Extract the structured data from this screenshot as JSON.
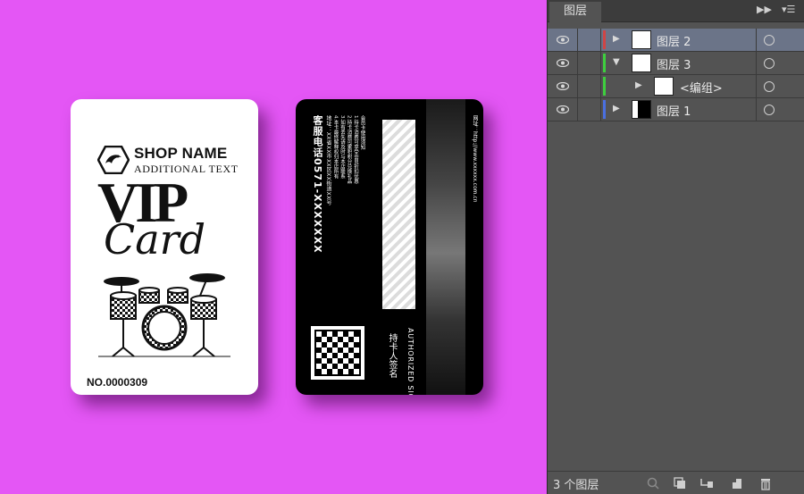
{
  "canvas": {
    "background": "#e456f5"
  },
  "card_front": {
    "shop_name": "SHOP NAME",
    "additional_text": "ADDITIONAL TEXT",
    "vip": "VIP",
    "card_word": "Card",
    "card_number": "NO.0000309"
  },
  "card_back": {
    "hotline": "客服电话0571-XXXXXXX",
    "address": "地址：XX省XX市XX区XX街道XX号",
    "rules": [
      "会员卡使用须知",
      "1.持卡消费可享受会员折扣优惠",
      "2.持卡消费可累积积分兑换礼品",
      "3.如有丢失请及时与本店联系",
      "4.本卡最终解释权归本店所有"
    ],
    "authorized_en": "AUTHORIZED SIGNATURE",
    "authorized_cn": "持卡人签名",
    "website": "网址：http://www.xxxxxx.com.cn"
  },
  "layers_panel": {
    "tab_title": "图层",
    "collapse_icon": "double-chevron-right-icon",
    "menu_icon": "panel-menu-icon",
    "layers": [
      {
        "name": "图层 2",
        "color": "#d04545",
        "expanded": false,
        "selected": true,
        "indent": 0
      },
      {
        "name": "图层 3",
        "color": "#3ecf3e",
        "expanded": true,
        "selected": false,
        "indent": 0
      },
      {
        "name": "<编组>",
        "color": "#3ecf3e",
        "expanded": false,
        "selected": false,
        "indent": 1
      },
      {
        "name": "图层 1",
        "color": "#4a6fe0",
        "expanded": false,
        "selected": false,
        "indent": 0
      }
    ],
    "footer": {
      "layer_count": "3 个图层",
      "icons": [
        "locate-object-icon",
        "make-clipping-mask-icon",
        "create-sublayer-icon",
        "create-new-layer-icon",
        "delete-icon"
      ]
    }
  }
}
